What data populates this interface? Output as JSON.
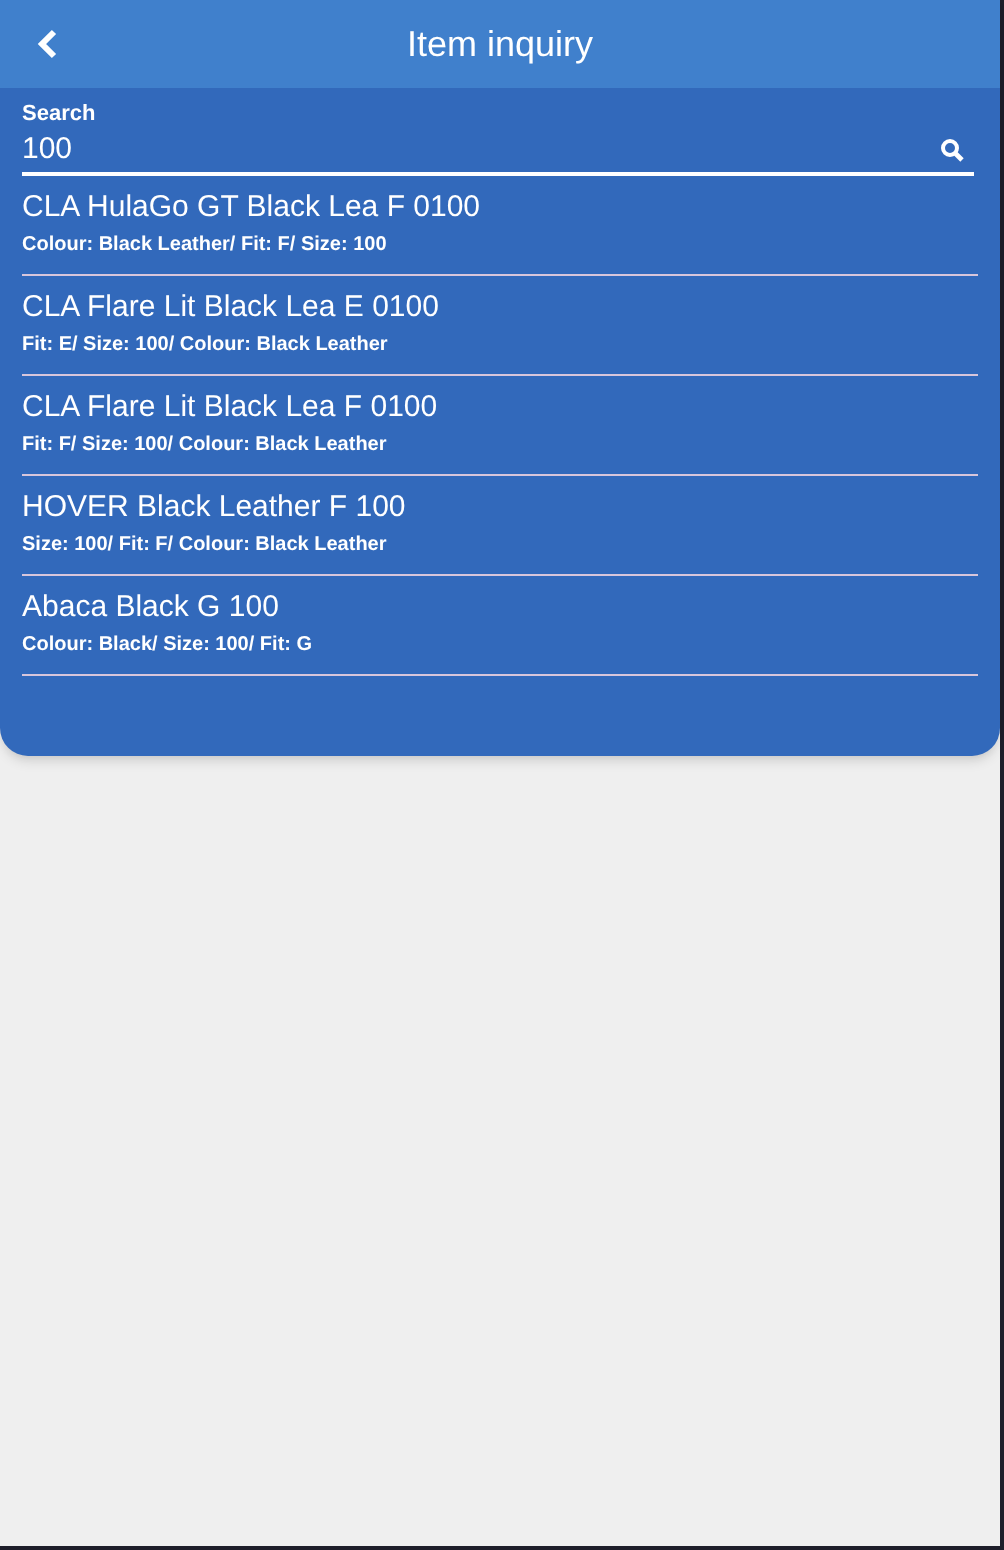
{
  "header": {
    "title": "Item inquiry"
  },
  "search": {
    "label": "Search",
    "value": "100"
  },
  "results": [
    {
      "name": "CLA HulaGo GT Black Lea F 0100",
      "details": "Colour: Black Leather/ Fit: F/ Size: 100"
    },
    {
      "name": "CLA Flare Lit Black Lea E 0100",
      "details": "Fit: E/ Size: 100/ Colour: Black Leather"
    },
    {
      "name": "CLA Flare Lit Black Lea F 0100",
      "details": "Fit: F/ Size: 100/ Colour: Black Leather"
    },
    {
      "name": "HOVER Black Leather F 100",
      "details": "Size: 100/ Fit: F/ Colour: Black Leather"
    },
    {
      "name": "Abaca Black G 100",
      "details": "Colour: Black/ Size: 100/ Fit: G"
    }
  ]
}
